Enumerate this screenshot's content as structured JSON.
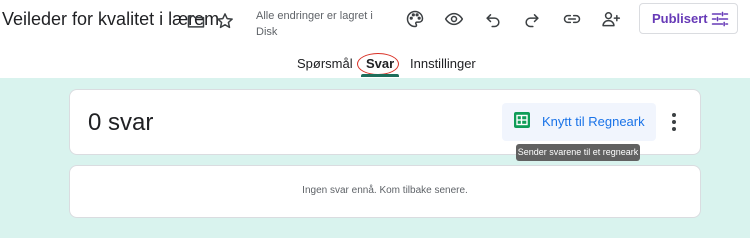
{
  "header": {
    "title": "Veileder for kvalitet i lærem",
    "saved_status": "Alle endringer er lagret i Disk",
    "publish_label": "Publisert",
    "icons": {
      "folder": "folder-icon",
      "star": "star-icon",
      "palette": "palette-icon",
      "preview": "eye-icon",
      "undo": "undo-icon",
      "redo": "redo-icon",
      "link": "link-icon",
      "add_collaborator": "add-person-icon",
      "publish": "tune-icon"
    }
  },
  "tabs": [
    {
      "label": "Spørsmål",
      "active": false
    },
    {
      "label": "Svar",
      "active": true
    },
    {
      "label": "Innstillinger",
      "active": false
    }
  ],
  "responses": {
    "count_title": "0 svar",
    "sheets_button_label": "Knytt til Regneark",
    "sheets_tooltip": "Sender svarene til et regneark",
    "empty_message": "Ingen svar ennå. Kom tilbake senere."
  },
  "colors": {
    "accent": "#673ab7",
    "tab_indicator": "#1e6e5b",
    "background": "#d9f3ee",
    "link": "#1a73e8",
    "sheets_green": "#0f9d58",
    "annotation_circle": "#d93025"
  }
}
